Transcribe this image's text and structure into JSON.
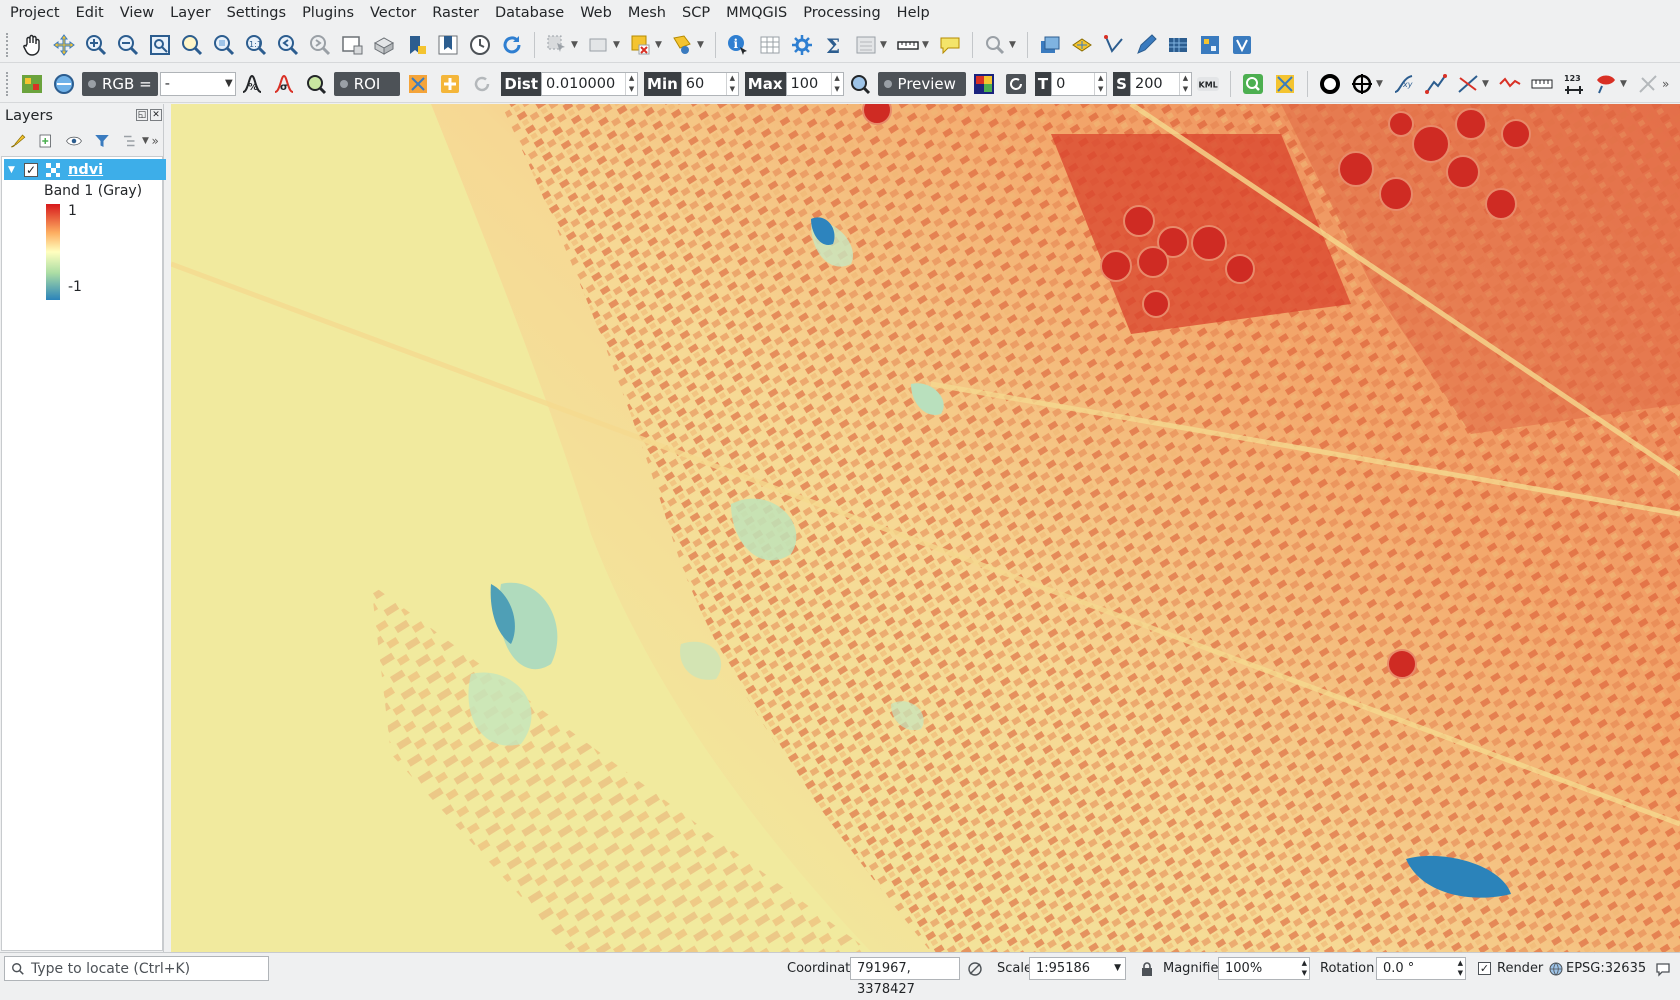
{
  "menu": [
    "Project",
    "Edit",
    "View",
    "Layer",
    "Settings",
    "Plugins",
    "Vector",
    "Raster",
    "Database",
    "Web",
    "Mesh",
    "SCP",
    "MMQGIS",
    "Processing",
    "Help"
  ],
  "scp_toolbar": {
    "rgb_label": "RGB =",
    "rgb_value": "-",
    "roi_label": "ROI",
    "dist_label": "Dist",
    "dist_value": "0.010000",
    "min_label": "Min",
    "min_value": "60",
    "max_label": "Max",
    "max_value": "100",
    "preview_label": "Preview",
    "t_label": "T",
    "t_value": "0",
    "s_label": "S",
    "s_value": "200",
    "kml_label": "KML",
    "digits_label": "123"
  },
  "layers_panel": {
    "title": "Layers",
    "layer_name": "ndvi",
    "band_label": "Band 1 (Gray)",
    "ramp_max": "1",
    "ramp_min": "-1",
    "ramp_colors": [
      "#d7191c",
      "#fdae61",
      "#ffffbf",
      "#abdda4",
      "#2b83ba"
    ]
  },
  "statusbar": {
    "locator_placeholder": "Type to locate (Ctrl+K)",
    "coordinate_label": "Coordinate",
    "coordinate_value": "791967, 3378427",
    "scale_label": "Scale",
    "scale_value": "1:95186",
    "magnifier_label": "Magnifier",
    "magnifier_value": "100%",
    "rotation_label": "Rotation",
    "rotation_value": "0.0 °",
    "render_label": "Render",
    "crs_label": "EPSG:32635"
  }
}
